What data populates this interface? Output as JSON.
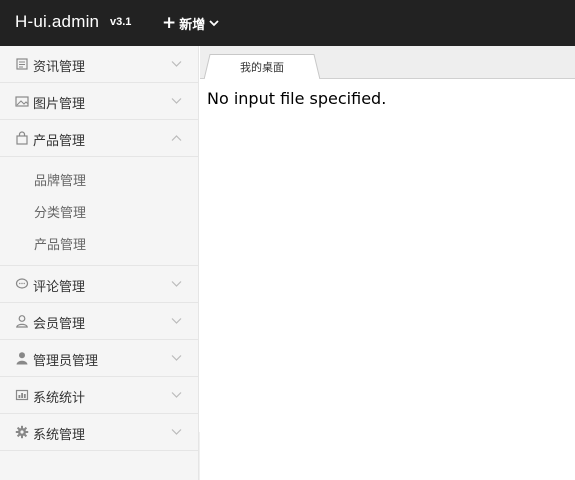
{
  "header": {
    "logo": "H-ui.admin",
    "version": "v3.1",
    "add_label": "新增",
    "plus": "+"
  },
  "sidebar": {
    "items": [
      {
        "label": "资讯管理",
        "icon": "news-icon",
        "expanded": false
      },
      {
        "label": "图片管理",
        "icon": "image-icon",
        "expanded": false
      },
      {
        "label": "产品管理",
        "icon": "bag-icon",
        "expanded": true,
        "children": [
          "品牌管理",
          "分类管理",
          "产品管理"
        ]
      },
      {
        "label": "评论管理",
        "icon": "comment-icon",
        "expanded": false
      },
      {
        "label": "会员管理",
        "icon": "user-outline-icon",
        "expanded": false
      },
      {
        "label": "管理员管理",
        "icon": "user-solid-icon",
        "expanded": false
      },
      {
        "label": "系统统计",
        "icon": "stats-icon",
        "expanded": false
      },
      {
        "label": "系统管理",
        "icon": "gear-icon",
        "expanded": false
      }
    ]
  },
  "tabs": [
    {
      "label": "我的桌面",
      "active": true
    }
  ],
  "content": {
    "message": "No input file specified."
  },
  "colors": {
    "topbar": "#222222",
    "sidebar": "#f5f5f5",
    "divider": "#e5e5e5"
  }
}
